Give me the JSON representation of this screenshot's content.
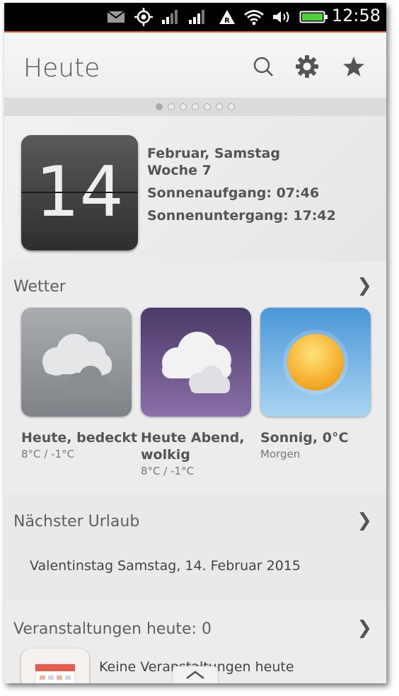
{
  "status_bar": {
    "time": "12:58",
    "icons": [
      "mail-icon",
      "gps-icon",
      "signal-1-icon",
      "signal-2-icon",
      "roaming-icon",
      "wifi-icon",
      "volume-icon",
      "battery-icon"
    ]
  },
  "header": {
    "title": "Heute",
    "actions": [
      "search-icon",
      "settings-icon",
      "favorite-star-icon"
    ]
  },
  "pager": {
    "count": 7,
    "active_index": 0
  },
  "date": {
    "day": "14",
    "line1": "Februar, Samstag",
    "line2": "Woche 7",
    "sunrise": "Sonnenaufgang: 07:46",
    "sunset": "Sonnenuntergang: 17:42"
  },
  "weather": {
    "title": "Wetter",
    "cards": [
      {
        "label_line1": "Heute, bedeckt",
        "label_line2": "",
        "sub": "8°C / -1°C",
        "icon": "overcast-icon"
      },
      {
        "label_line1": "Heute Abend,",
        "label_line2": "wolkig",
        "sub": "8°C / -1°C",
        "icon": "cloudy-night-icon"
      },
      {
        "label_line1": "Sonnig, 0°C",
        "label_line2": "",
        "sub": "Morgen",
        "icon": "sunny-icon"
      }
    ]
  },
  "holiday": {
    "title": "Nächster Urlaub",
    "text": "Valentinstag Samstag, 14. Februar 2015"
  },
  "events": {
    "title": "Veranstaltungen heute: 0",
    "text": "Keine Veranstaltungen heute"
  },
  "colors": {
    "accent": "#e05a1c",
    "overcast_bg": "#8e9296",
    "night_bg": "#5e4a7e",
    "sunny_bg": "#5aa7e0"
  }
}
